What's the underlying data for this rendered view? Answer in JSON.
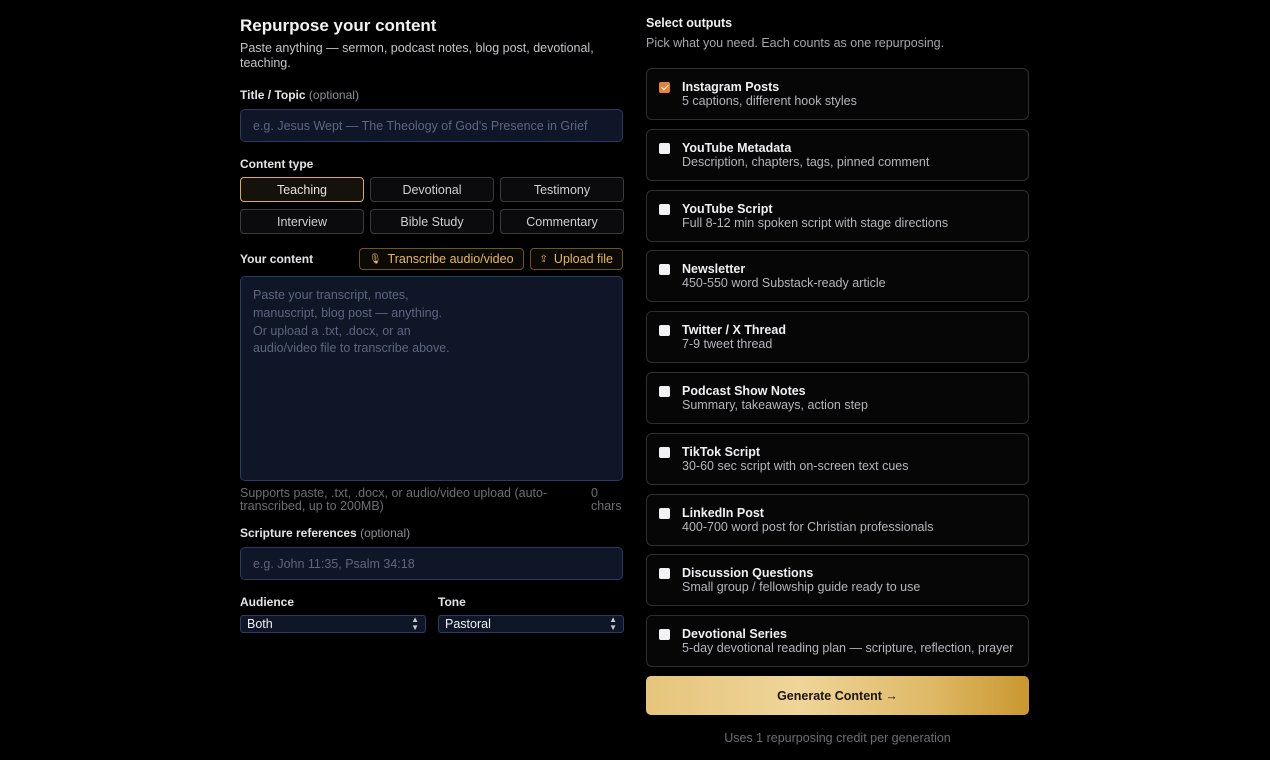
{
  "header": {
    "title": "Repurpose your content",
    "subtitle": "Paste anything — sermon, podcast notes, blog post, devotional, teaching."
  },
  "title_field": {
    "label": "Title / Topic",
    "optional": "(optional)",
    "placeholder": "e.g. Jesus Wept — The Theology of God's Presence in Grief"
  },
  "content_type": {
    "label": "Content type",
    "options": [
      "Teaching",
      "Devotional",
      "Testimony",
      "Interview",
      "Bible Study",
      "Commentary"
    ],
    "selected": "Teaching"
  },
  "content": {
    "label": "Your content",
    "transcribe_icon": "microphone-icon",
    "transcribe_label": "Transcribe audio/video",
    "upload_icon": "upload-icon",
    "upload_label": "Upload file",
    "placeholder": "Paste your transcript, notes, manuscript, blog post — anything. Or upload a .txt, .docx, or an audio/video file to transcribe above.",
    "help": "Supports paste, .txt, .docx, or audio/video upload (auto-transcribed, up to 200MB)",
    "count": "0 chars"
  },
  "scripture": {
    "label": "Scripture references",
    "optional": "(optional)",
    "placeholder": "e.g. John 11:35, Psalm 34:18"
  },
  "audience": {
    "label": "Audience",
    "value": "Both"
  },
  "tone": {
    "label": "Tone",
    "value": "Pastoral"
  },
  "outputs": {
    "title": "Select outputs",
    "subtitle": "Pick what you need. Each counts as one repurposing.",
    "items": [
      {
        "title": "Instagram Posts",
        "desc": "5 captions, different hook styles",
        "checked": true
      },
      {
        "title": "YouTube Metadata",
        "desc": "Description, chapters, tags, pinned comment",
        "checked": false
      },
      {
        "title": "YouTube Script",
        "desc": "Full 8-12 min spoken script with stage directions",
        "checked": false
      },
      {
        "title": "Newsletter",
        "desc": "450-550 word Substack-ready article",
        "checked": false
      },
      {
        "title": "Twitter / X Thread",
        "desc": "7-9 tweet thread",
        "checked": false
      },
      {
        "title": "Podcast Show Notes",
        "desc": "Summary, takeaways, action step",
        "checked": false
      },
      {
        "title": "TikTok Script",
        "desc": "30-60 sec script with on-screen text cues",
        "checked": false
      },
      {
        "title": "LinkedIn Post",
        "desc": "400-700 word post for Christian professionals",
        "checked": false
      },
      {
        "title": "Discussion Questions",
        "desc": "Small group / fellowship guide ready to use",
        "checked": false
      },
      {
        "title": "Devotional Series",
        "desc": "5-day devotional reading plan — scripture, reflection, prayer",
        "checked": false
      }
    ]
  },
  "generate": {
    "label": "Generate Content →",
    "note": "Uses 1 repurposing credit per generation"
  },
  "colors": {
    "accent": "#d9ac55",
    "checked": "#e8823a",
    "input_bg": "#0f1628"
  }
}
